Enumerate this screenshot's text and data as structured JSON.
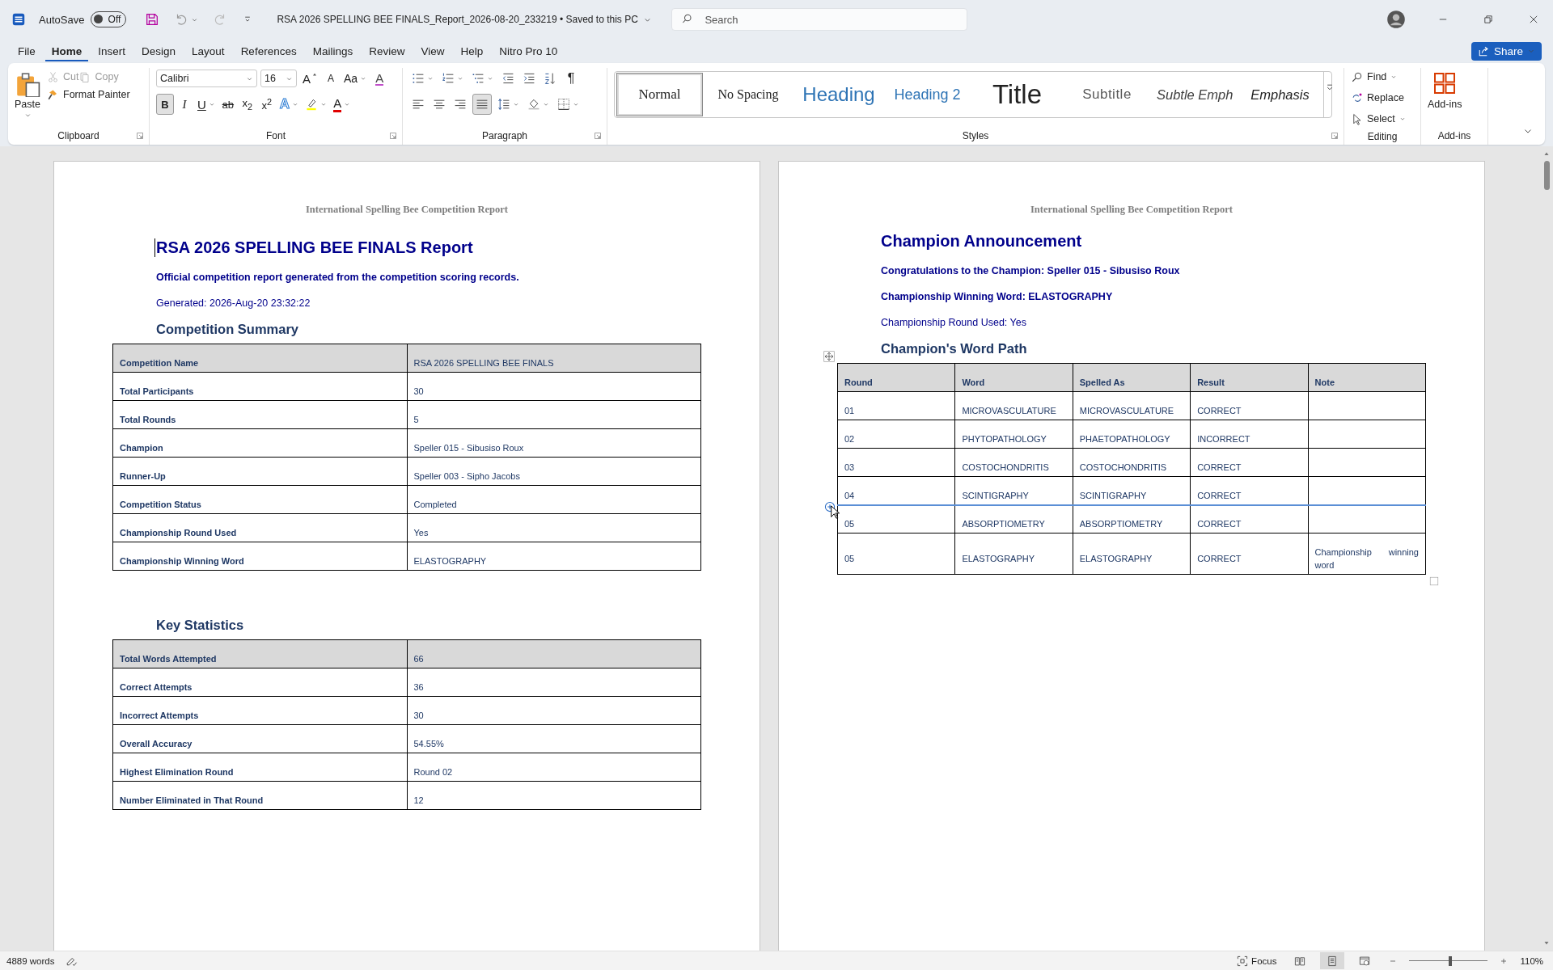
{
  "title_bar": {
    "autosave_label": "AutoSave",
    "autosave": {
      "on": false,
      "label": "Off"
    },
    "document_title": "RSA 2026 SPELLING BEE FINALS_Report_2026-08-20_233219",
    "separator": "•",
    "save_status": "Saved to this PC",
    "search": {
      "placeholder": "Search"
    }
  },
  "menu_tabs": [
    {
      "label": "File",
      "selected": false
    },
    {
      "label": "Home",
      "selected": true
    },
    {
      "label": "Insert",
      "selected": false
    },
    {
      "label": "Design",
      "selected": false
    },
    {
      "label": "Layout",
      "selected": false
    },
    {
      "label": "References",
      "selected": false
    },
    {
      "label": "Mailings",
      "selected": false
    },
    {
      "label": "Review",
      "selected": false
    },
    {
      "label": "View",
      "selected": false
    },
    {
      "label": "Help",
      "selected": false
    },
    {
      "label": "Nitro Pro 10",
      "selected": false
    }
  ],
  "share_button": {
    "label": "Share"
  },
  "ribbon": {
    "clipboard": {
      "label": "Clipboard",
      "paste": "Paste",
      "items": [
        {
          "kind": "cut",
          "label": "Cut",
          "disabled": true
        },
        {
          "kind": "copy",
          "label": "Copy",
          "disabled": true
        },
        {
          "kind": "painter",
          "label": "Format Painter",
          "disabled": false
        }
      ]
    },
    "font": {
      "label": "Font",
      "font_name": "Calibri",
      "font_size": "16",
      "row1": [
        {
          "kind": "grow",
          "label": "A"
        },
        {
          "kind": "shrink",
          "label": "A"
        },
        {
          "kind": "case",
          "label": "Aa"
        },
        {
          "kind": "clear",
          "label": "A"
        }
      ],
      "row2": [
        {
          "kind": "bold",
          "label": "B",
          "selected": true
        },
        {
          "kind": "italic",
          "label": "I",
          "selected": false
        },
        {
          "kind": "underline",
          "label": "U",
          "selected": false
        },
        {
          "kind": "strike",
          "label": "ab",
          "selected": false
        },
        {
          "kind": "subscript",
          "label": "x$_{2}$",
          "selected": false
        },
        {
          "kind": "superscript",
          "label": "x$^{2}$",
          "selected": false
        },
        {
          "kind": "effects",
          "label": "A",
          "selected": false
        },
        {
          "kind": "highlight",
          "selected": false
        },
        {
          "kind": "color",
          "label": "A",
          "selected": false
        }
      ]
    },
    "paragraph": {
      "label": "Paragraph",
      "row1": [
        {
          "kind": "bullets",
          "selected": false
        },
        {
          "kind": "numbering",
          "selected": false
        },
        {
          "kind": "multilevel",
          "selected": false
        },
        {
          "kind": "outdent",
          "selected": false
        },
        {
          "kind": "indent",
          "selected": false
        },
        {
          "kind": "sort",
          "selected": false
        },
        {
          "kind": "marks",
          "label": "¶",
          "selected": false
        }
      ],
      "row2": [
        {
          "kind": "align_left",
          "selected": false
        },
        {
          "kind": "align_center",
          "selected": false
        },
        {
          "kind": "align_right",
          "selected": false
        },
        {
          "kind": "justify",
          "selected": true
        },
        {
          "kind": "spacing",
          "selected": false
        },
        {
          "kind": "shading",
          "selected": false
        },
        {
          "kind": "borders",
          "selected": false
        }
      ]
    },
    "styles": {
      "label": "Styles",
      "items": [
        {
          "kind": "normal",
          "label": "Normal",
          "selected": true
        },
        {
          "kind": "no_spacing",
          "label": "No Spacing",
          "selected": false
        },
        {
          "kind": "heading1",
          "label": "Heading",
          "selected": false
        },
        {
          "kind": "heading2",
          "label": "Heading 2",
          "selected": false
        },
        {
          "kind": "title",
          "label": "Title",
          "selected": false
        },
        {
          "kind": "subtitle",
          "label": "Subtitle",
          "selected": false
        },
        {
          "kind": "subtle",
          "label": "Subtle Emph",
          "selected": false
        },
        {
          "kind": "emphasis",
          "label": "Emphasis",
          "selected": false
        }
      ]
    },
    "editing": {
      "label": "Editing",
      "items": [
        {
          "kind": "find",
          "label": "Find"
        },
        {
          "kind": "replace",
          "label": "Replace"
        },
        {
          "kind": "select",
          "label": "Select"
        }
      ]
    },
    "addins": {
      "label": "Add-ins",
      "button": "Add-ins"
    }
  },
  "pages": [
    {
      "header": "International Spelling Bee Competition Report",
      "title": "RSA 2026 SPELLING BEE FINALS Report",
      "lines": [
        {
          "kind": "strong",
          "text": "Official competition report generated from the competition scoring records."
        },
        {
          "kind": "plain",
          "text": "Generated: 2026-Aug-20 23:32:22"
        }
      ],
      "sections": [
        {
          "heading": "Competition Summary",
          "columns": [
            "Competition Name",
            "RSA 2026 SPELLING BEE FINALS"
          ],
          "rows": [
            [
              "Total Participants",
              "30"
            ],
            [
              "Total Rounds",
              "5"
            ],
            [
              "Champion",
              "Speller 015 - Sibusiso Roux"
            ],
            [
              "Runner-Up",
              "Speller 003 - Sipho Jacobs"
            ],
            [
              "Competition Status",
              "Completed"
            ],
            [
              "Championship Round Used",
              "Yes"
            ],
            [
              "Championship Winning Word",
              "ELASTOGRAPHY"
            ]
          ]
        },
        {
          "heading": "Key Statistics",
          "columns": [
            "Total Words Attempted",
            "66"
          ],
          "rows": [
            [
              "Correct Attempts",
              "36"
            ],
            [
              "Incorrect Attempts",
              "30"
            ],
            [
              "Overall Accuracy",
              "54.55%"
            ],
            [
              "Highest Elimination Round",
              "Round 02"
            ],
            [
              "Number Eliminated in That Round",
              "12"
            ]
          ]
        }
      ]
    },
    {
      "header": "International Spelling Bee Competition Report",
      "title": "Champion Announcement",
      "lines": [
        {
          "kind": "strong",
          "text": "Congratulations to the Champion: Speller 015 - Sibusiso Roux"
        },
        {
          "kind": "strong",
          "text": "Championship Winning Word: ELASTOGRAPHY"
        },
        {
          "kind": "plain",
          "text": "Championship Round Used: Yes"
        }
      ],
      "sections": [
        {
          "heading": "Champion's Word Path",
          "columns": [
            "Round",
            "Word",
            "Spelled As",
            "Result",
            "Note"
          ],
          "rows": [
            [
              "01",
              "MICROVASCULATURE",
              "MICROVASCULATURE",
              "CORRECT",
              ""
            ],
            [
              "02",
              "PHYTOPATHOLOGY",
              "PHAETOPATHOLOGY",
              "INCORRECT",
              ""
            ],
            [
              "03",
              "COSTOCHONDRITIS",
              "COSTOCHONDRITIS",
              "CORRECT",
              ""
            ],
            [
              "04",
              "SCINTIGRAPHY",
              "SCINTIGRAPHY",
              "CORRECT",
              ""
            ],
            [
              "05",
              "ABSORPTIOMETRY",
              "ABSORPTIOMETRY",
              "CORRECT",
              ""
            ],
            [
              "05",
              "ELASTOGRAPHY",
              "ELASTOGRAPHY",
              "CORRECT",
              "Championship winning word"
            ]
          ]
        }
      ]
    }
  ],
  "status_bar": {
    "word_count": "4889 words",
    "focus": "Focus",
    "views": [
      {
        "kind": "read",
        "selected": false
      },
      {
        "kind": "print",
        "selected": true
      },
      {
        "kind": "web",
        "selected": false
      }
    ],
    "zoom": {
      "level": 0.52,
      "label": "110%"
    }
  }
}
